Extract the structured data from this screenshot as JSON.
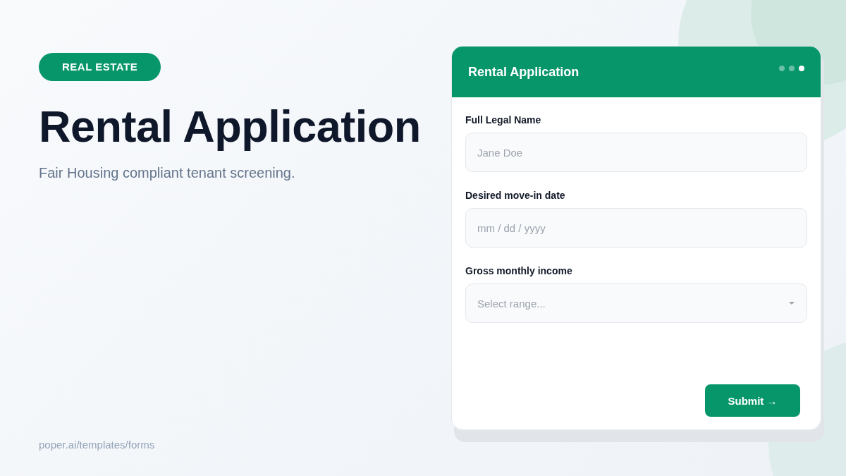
{
  "badge": "REAL ESTATE",
  "headline": "Rental Application",
  "subtitle": "Fair Housing compliant tenant screening.",
  "footer_link": "poper.ai/templates/forms",
  "form": {
    "title": "Rental Application",
    "steps": [
      {
        "selected": false
      },
      {
        "selected": false
      },
      {
        "selected": true
      }
    ],
    "fields": [
      {
        "kind": "text",
        "label": "Full Legal Name",
        "placeholder": "Jane Doe"
      },
      {
        "kind": "date",
        "label": "Desired move-in date",
        "placeholder": "mm / dd / yyyy"
      },
      {
        "kind": "select",
        "label": "Gross monthly income",
        "placeholder": "Select range..."
      }
    ],
    "submit": "Submit →"
  }
}
